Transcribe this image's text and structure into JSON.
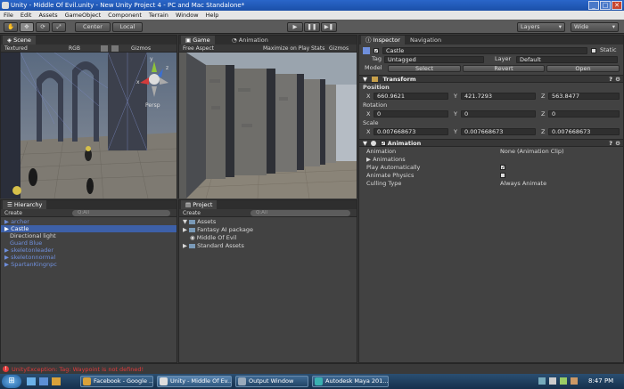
{
  "window": {
    "title": "Unity - Middle Of Evil.unity - New Unity Project 4 - PC and Mac Standalone*",
    "min": "_",
    "max": "□",
    "close": "✕"
  },
  "menu": [
    "File",
    "Edit",
    "Assets",
    "GameObject",
    "Component",
    "Terrain",
    "Window",
    "Help"
  ],
  "toolbar": {
    "hand": "✋",
    "move": "✥",
    "rotate": "⟳",
    "scale": "⤢",
    "center": "Center",
    "local": "Local",
    "play": "▶",
    "pause": "❚❚",
    "step": "▶❚",
    "layers": "Layers",
    "layout": "Wide"
  },
  "scene": {
    "tab": "Scene",
    "mode": "Textured",
    "render": "RGB",
    "gizmos": "Gizmos",
    "search": "Q:All",
    "persp": "Persp",
    "axis_y": "y",
    "axis_x": "x",
    "axis_z": "z"
  },
  "game": {
    "tab": "Game",
    "anim_tab": "Animation",
    "aspect": "Free Aspect",
    "maximize": "Maximize on Play",
    "stats": "Stats",
    "gizmos": "Gizmos"
  },
  "hierarchy": {
    "tab": "Hierarchy",
    "create": "Create",
    "search": "Q:All",
    "items": [
      {
        "label": "archer",
        "type": "prefab",
        "arrow": "▶"
      },
      {
        "label": "Castle",
        "type": "selected",
        "arrow": "▶"
      },
      {
        "label": "Directional light",
        "type": "plain",
        "arrow": ""
      },
      {
        "label": "Guard Blue",
        "type": "prefab",
        "arrow": ""
      },
      {
        "label": "skeletonleader",
        "type": "prefab",
        "arrow": "▶"
      },
      {
        "label": "skeletonnormal",
        "type": "prefab",
        "arrow": "▶"
      },
      {
        "label": "SpartanKingnpc",
        "type": "prefab",
        "arrow": "▶"
      }
    ]
  },
  "project": {
    "tab": "Project",
    "create": "Create",
    "search": "Q:All",
    "items": [
      {
        "label": "Assets",
        "indent": 0,
        "arrow": "▼"
      },
      {
        "label": "Fantasy AI package",
        "indent": 1,
        "arrow": "▶"
      },
      {
        "label": "Middle Of Evil",
        "indent": 1,
        "arrow": ""
      },
      {
        "label": "Standard Assets",
        "indent": 1,
        "arrow": "▶"
      }
    ]
  },
  "inspector": {
    "tab": "Inspector",
    "nav_tab": "Navigation",
    "object_name": "Castle",
    "static": "Static",
    "tag_label": "Tag",
    "tag_value": "Untagged",
    "layer_label": "Layer",
    "layer_value": "Default",
    "model_label": "Model",
    "select": "Select",
    "revert": "Revert",
    "open": "Open",
    "transform": {
      "title": "Transform",
      "position_label": "Position",
      "rotation_label": "Rotation",
      "scale_label": "Scale",
      "x": "X",
      "y": "Y",
      "z": "Z",
      "pos": [
        "660.9621",
        "421.7293",
        "563.8477"
      ],
      "rot": [
        "0",
        "0",
        "0"
      ],
      "scl": [
        "0.007668673",
        "0.007668673",
        "0.007668673"
      ]
    },
    "animation": {
      "title": "Animation",
      "rows": [
        {
          "label": "Animation",
          "value": "None (Animation Clip)"
        },
        {
          "label": "▶ Animations",
          "value": ""
        },
        {
          "label": "Play Automatically",
          "value": "✓"
        },
        {
          "label": "Animate Physics",
          "value": ""
        },
        {
          "label": "Culling Type",
          "value": "Always Animate"
        }
      ]
    }
  },
  "status": {
    "message": "UnityException: Tag: Waypoint is not defined!"
  },
  "taskbar": {
    "start": "⊞",
    "apps": [
      "Facebook - Google ...",
      "Unity - Middle Of Ev...",
      "Output Window",
      "Autodesk Maya 201..."
    ],
    "time": "8:47 PM"
  },
  "colors": {
    "accent": "#3d60a8",
    "prefab": "#6f8fdc",
    "error": "#e23b3b"
  }
}
